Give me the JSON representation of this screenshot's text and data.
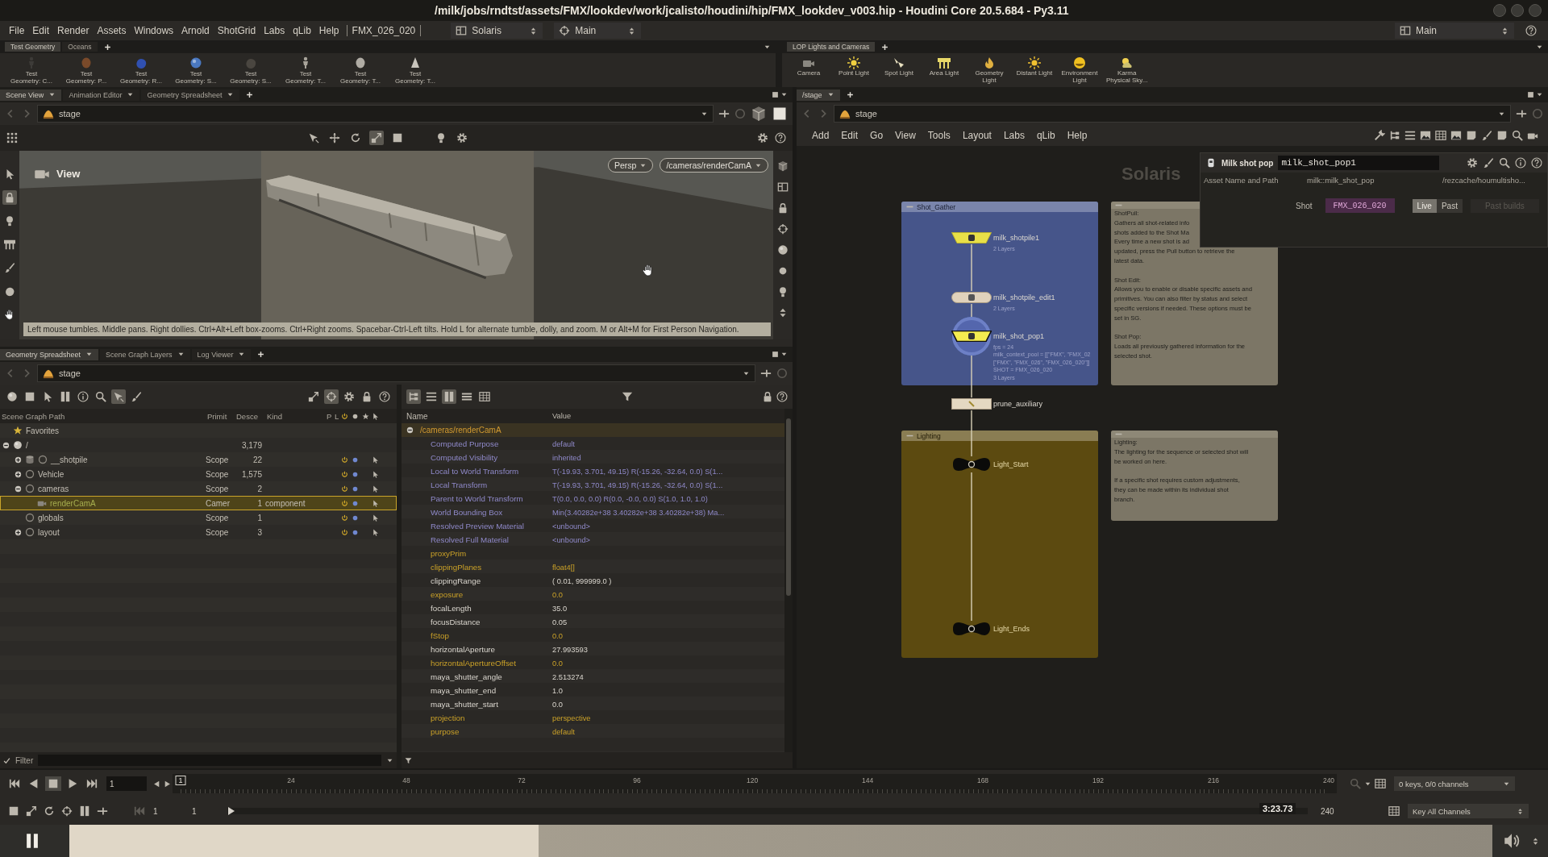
{
  "window": {
    "title": "/milk/jobs/rndtst/assets/FMX/lookdev/work/jcalisto/houdini/hip/FMX_lookdev_v003.hip - Houdini Core 20.5.684 - Py3.11"
  },
  "menu_bar": {
    "items": [
      "File",
      "Edit",
      "Render",
      "Assets",
      "Windows",
      "Arnold",
      "ShotGrid",
      "Labs",
      "qLib",
      "Help"
    ],
    "context": "FMX_026_020",
    "desktop": "Solaris",
    "layout": "Main",
    "right_layout": "Main"
  },
  "shelves": [
    {
      "tabs": [
        {
          "label": "Test Geometry",
          "selected": true
        },
        {
          "label": "Oceans",
          "selected": false
        }
      ],
      "tools": [
        "Test\nGeometry: C...",
        "Test\nGeometry: P...",
        "Test\nGeometry: R...",
        "Test\nGeometry: S...",
        "Test\nGeometry: S...",
        "Test\nGeometry: T...",
        "Test\nGeometry: T...",
        "Test\nGeometry: T..."
      ]
    },
    {
      "tabs": [
        {
          "label": "LOP Lights and Cameras",
          "selected": true
        }
      ],
      "tools": [
        "Camera",
        "Point Light",
        "Spot Light",
        "Area Light",
        "Geometry\nLight",
        "Distant Light",
        "Environment\nLight",
        "Karma\nPhysical Sky..."
      ]
    }
  ],
  "scene_view": {
    "tabs": [
      {
        "label": "Scene View",
        "selected": true
      },
      {
        "label": "Animation Editor",
        "selected": false
      },
      {
        "label": "Geometry Spreadsheet",
        "selected": false
      }
    ],
    "path": "stage",
    "tools": [
      {
        "on": false
      },
      {
        "on": false
      },
      {
        "on": false
      },
      {
        "on": true
      },
      {
        "on": false
      }
    ],
    "side_tools": [
      {
        "on": false
      },
      {
        "on": true
      },
      {
        "on": false
      },
      {
        "on": false
      },
      {
        "on": false
      },
      {
        "on": false
      },
      {
        "on": false
      }
    ],
    "view_label": "View",
    "projection": "Persp",
    "camera": "/cameras/renderCamA",
    "hint": "Left mouse tumbles. Middle pans. Right dollies. Ctrl+Alt+Left box-zooms. Ctrl+Right zooms. Spacebar-Ctrl-Left tilts. Hold L for alternate tumble, dolly, and zoom. M or Alt+M for First Person Navigation."
  },
  "lower_pane": {
    "tabs": [
      {
        "label": "Geometry Spreadsheet",
        "selected": true
      },
      {
        "label": "Scene Graph Layers",
        "selected": false
      },
      {
        "label": "Log Viewer",
        "selected": false
      }
    ],
    "path": "stage"
  },
  "scene_graph": {
    "tools": [
      {
        "on": false
      },
      {
        "on": false
      },
      {
        "on": false
      },
      {
        "on": false
      },
      {
        "on": false
      },
      {
        "on": false
      },
      {
        "on": true
      },
      {
        "on": false
      }
    ],
    "tools_right": [
      {
        "on": false
      },
      {
        "on": true
      },
      {
        "on": false
      },
      {
        "on": false
      },
      {
        "on": false
      }
    ],
    "columns": [
      "Scene Graph Path",
      "Primit",
      "Desce",
      "Kind",
      "P",
      "L"
    ],
    "rows": [
      {
        "name": "Favorites",
        "kind": "favorites",
        "selected": false
      },
      {
        "name": "/",
        "kind": "root",
        "descendants": "3,179",
        "expanded": true,
        "selected": false,
        "children": [
          {
            "name": "__shotpile",
            "kind": "database",
            "type": "Scope",
            "descendants": "22",
            "expanded": false,
            "selected": false
          },
          {
            "name": "Vehicle",
            "kind": "prim",
            "type": "Scope",
            "descendants": "1,575",
            "expanded": false,
            "selected": false
          },
          {
            "name": "cameras",
            "kind": "prim",
            "type": "Scope",
            "descendants": "2",
            "expanded": true,
            "selected": false,
            "children": [
              {
                "name": "renderCamA",
                "kind": "camera",
                "type": "Camer",
                "descendants": "1",
                "model_kind": "component",
                "selected": true
              }
            ]
          },
          {
            "name": "globals",
            "kind": "prim",
            "type": "Scope",
            "descendants": "1",
            "selected": false
          },
          {
            "name": "layout",
            "kind": "prim",
            "type": "Scope",
            "descendants": "3",
            "expanded": false,
            "selected": false
          }
        ]
      }
    ],
    "filter": "Filter"
  },
  "properties": {
    "tools": [
      {
        "on": true
      },
      {
        "on": false
      },
      {
        "on": true
      },
      {
        "on": false
      },
      {
        "on": false
      }
    ],
    "columns": [
      "Name",
      "Value"
    ],
    "prim": "/cameras/renderCamA",
    "expanded": true,
    "rows": [
      {
        "name": "Computed Purpose",
        "value": "default",
        "kind": "computed"
      },
      {
        "name": "Computed Visibility",
        "value": "inherited",
        "kind": "computed"
      },
      {
        "name": "Local to World Transform",
        "value": "T(-19.93, 3.701, 49.15) R(-15.26, -32.64, 0.0) S(1...",
        "kind": "computed"
      },
      {
        "name": "Local Transform",
        "value": "T(-19.93, 3.701, 49.15) R(-15.26, -32.64, 0.0) S(1...",
        "kind": "computed"
      },
      {
        "name": "Parent to World Transform",
        "value": "T(0.0, 0.0, 0.0) R(0.0, -0.0, 0.0) S(1.0, 1.0, 1.0)",
        "kind": "computed"
      },
      {
        "name": "World Bounding Box",
        "value": "Min(3.40282e+38 3.40282e+38 3.40282e+38) Ma...",
        "kind": "computed"
      },
      {
        "name": "Resolved Preview Material",
        "value": "<unbound>",
        "kind": "computed"
      },
      {
        "name": "Resolved Full Material",
        "value": "<unbound>",
        "kind": "computed"
      },
      {
        "name": "proxyPrim",
        "kind": "fallback"
      },
      {
        "name": "clippingPlanes",
        "value": "float4[]",
        "kind": "fallback"
      },
      {
        "name": "clippingRange",
        "value": "( 0.01, 999999.0 )",
        "kind": "authored"
      },
      {
        "name": "exposure",
        "value": "0.0",
        "kind": "fallback"
      },
      {
        "name": "focalLength",
        "value": "35.0",
        "kind": "authored"
      },
      {
        "name": "focusDistance",
        "value": "0.05",
        "kind": "authored"
      },
      {
        "name": "fStop",
        "value": "0.0",
        "kind": "fallback"
      },
      {
        "name": "horizontalAperture",
        "value": "27.993593",
        "kind": "authored"
      },
      {
        "name": "horizontalApertureOffset",
        "value": "0.0",
        "kind": "fallback"
      },
      {
        "name": "maya_shutter_angle",
        "value": "2.513274",
        "kind": "authored"
      },
      {
        "name": "maya_shutter_end",
        "value": "1.0",
        "kind": "authored"
      },
      {
        "name": "maya_shutter_start",
        "value": "0.0",
        "kind": "authored"
      },
      {
        "name": "projection",
        "value": "perspective",
        "kind": "fallback"
      },
      {
        "name": "purpose",
        "value": "default",
        "kind": "fallback"
      }
    ]
  },
  "network": {
    "tabs": [
      {
        "label": "/stage",
        "selected": true
      }
    ],
    "path": "stage",
    "menu": [
      "Add",
      "Edit",
      "Go",
      "View",
      "Tools",
      "Layout",
      "Labs",
      "qLib",
      "Help"
    ],
    "context_label": "Solaris",
    "boxes": [
      {
        "title": "Shot_Gather",
        "color": "#46558a"
      },
      {
        "title": "Lighting",
        "color": "#5c4a10"
      }
    ],
    "notes": [
      {
        "paragraphs": [
          [
            "ShotPull:\nGathers all shot-related info\nshots added to the Shot Ma\nEvery time a new shot is ad",
            "updated, press the Pull button to retrieve the\nlatest data."
          ],
          [
            "Shot Edit:\nAllows you to enable or disable specific assets and\nprimitives. You can also filter by status and select\nspecific versions if needed. These options must be\nset in SG."
          ],
          [
            "Shot Pop:\nLoads all previously gathered information for the\nselected shot."
          ]
        ]
      },
      {
        "paragraphs": [
          [
            "Lighting:\nThe lighting for the sequence or selected shot will\nbe worked on here."
          ],
          [
            "If a specific shot requires custom adjustments,\nthey can be made within its individual shot\nbranch."
          ]
        ]
      }
    ],
    "nodes": [
      {
        "name": "milk_shotpile1",
        "kind": "hda",
        "selected": false,
        "info": [
          "2 Layers"
        ]
      },
      {
        "name": "milk_shotpile_edit1",
        "kind": "edit",
        "selected": false,
        "info": [
          "2 Layers"
        ]
      },
      {
        "name": "milk_shot_pop1",
        "kind": "hda",
        "selected": true,
        "info": [
          "fps = 24",
          "milk_context_pool = [[\"FMX\", \"FMX_02",
          "[\"FMX\", \"FMX_026\", \"FMX_026_020\"]]",
          "SHOT = FMX_026_020",
          "3 Layers"
        ]
      },
      {
        "name": "prune_auxiliary",
        "kind": "prune",
        "selected": false
      },
      {
        "name": "Light_Start",
        "kind": "null",
        "selected": false
      },
      {
        "name": "Light_Ends",
        "kind": "null",
        "selected": false
      }
    ]
  },
  "parameters": {
    "type_label": "Milk shot pop",
    "node_name": "milk_shot_pop1",
    "asset_label": "Asset Name and Path",
    "asset_name": "milk::milk_shot_pop",
    "asset_path": "/rezcache/houmultisho...",
    "shot_label": "Shot",
    "shot": "FMX_026_020",
    "modes": [
      {
        "label": "Live",
        "selected": true
      },
      {
        "label": "Past",
        "selected": false
      }
    ],
    "past_builds": {
      "label": "Past builds",
      "disabled": true
    }
  },
  "timeline": {
    "stopped": true,
    "frame": "1",
    "marker": "1",
    "ticks": [
      "24",
      "48",
      "72",
      "96",
      "120",
      "144",
      "168",
      "192",
      "216",
      "240"
    ],
    "range_start": "1",
    "range_current": "1",
    "range_end": "240",
    "keys": "0 keys, 0/0 channels",
    "key_mode": "Key All Channels"
  },
  "video_player": {
    "playing": true,
    "level": 0.33,
    "time": "3:23.73"
  }
}
